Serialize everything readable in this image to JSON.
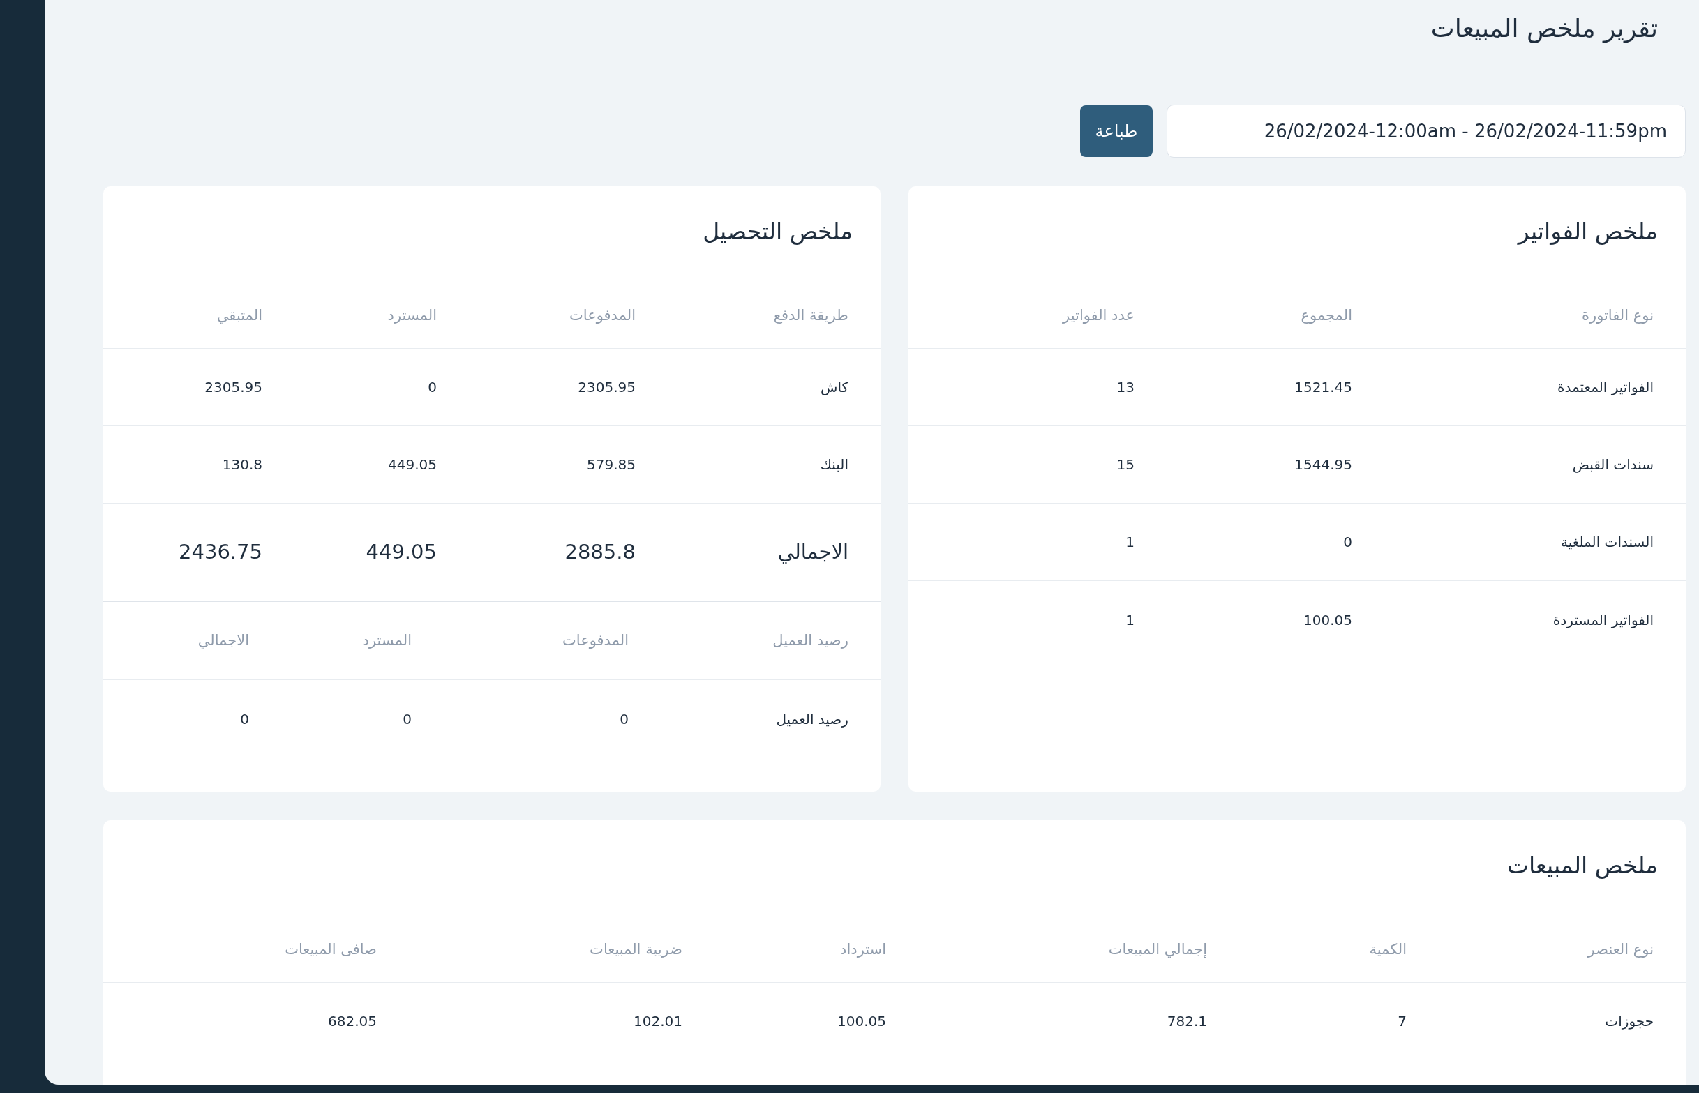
{
  "title": "تقرير ملخص المبيعات",
  "date_range": {
    "value": "26/02/2024-12:00am - 26/02/2024-11:59pm"
  },
  "print_button": {
    "label": "طباعة"
  },
  "invoices_summary": {
    "title": "ملخص الفواتير",
    "columns": [
      "نوع الفاتورة",
      "المجموع",
      "عدد الفواتير"
    ],
    "rows": [
      [
        "الفواتير المعتمدة",
        "1521.45",
        "13"
      ],
      [
        "سندات القبض",
        "1544.95",
        "15"
      ],
      [
        "السندات الملغية",
        "0",
        "1"
      ],
      [
        "الفواتير المستردة",
        "100.05",
        "1"
      ]
    ]
  },
  "collection_summary": {
    "title": "ملخص التحصيل",
    "columns": [
      "طريقة الدفع",
      "المدفوعات",
      "المسترد",
      "المتبقي"
    ],
    "rows": [
      [
        "كاش",
        "2305.95",
        "0",
        "2305.95"
      ],
      [
        "البنك",
        "579.85",
        "449.05",
        "130.8"
      ]
    ],
    "total": [
      "الاجمالي",
      "2885.8",
      "449.05",
      "2436.75"
    ],
    "balance": {
      "columns": [
        "رصيد العميل",
        "المدفوعات",
        "المسترد",
        "الاجمالي"
      ],
      "rows": [
        [
          "رصيد العميل",
          "0",
          "0",
          "0"
        ]
      ]
    }
  },
  "sales_summary": {
    "title": "ملخص المبيعات",
    "columns": [
      "نوع العنصر",
      "الكمية",
      "إجمالي المبيعات",
      "استرداد",
      "ضريبة المبيعات",
      "صافى المبيعات"
    ],
    "rows": [
      [
        "حجوزات",
        "7",
        "782.1",
        "100.05",
        "102.01",
        "682.05"
      ]
    ]
  }
}
